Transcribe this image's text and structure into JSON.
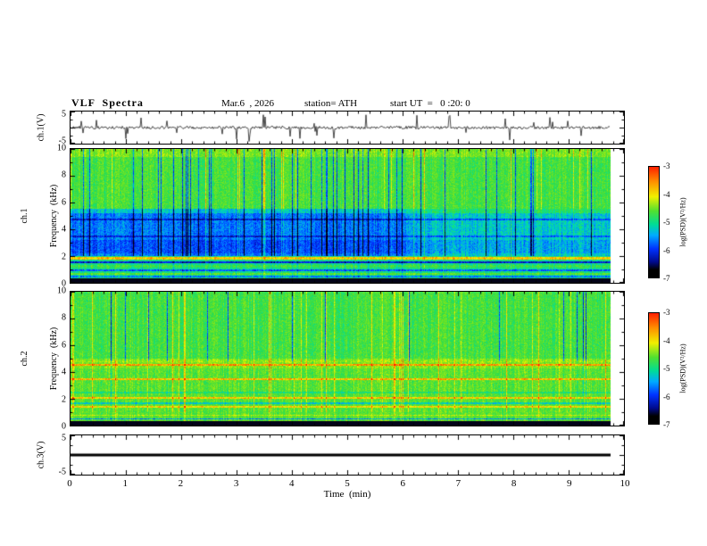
{
  "header": {
    "title": "VLF  Spectra",
    "date": "Mar.6  , 2026",
    "station": "station= ATH",
    "start_ut": "start UT  =   0 :20: 0"
  },
  "xaxis": {
    "label": "Time  (min)",
    "ticks": [
      "0",
      "1",
      "2",
      "3",
      "4",
      "5",
      "6",
      "7",
      "8",
      "9",
      "10"
    ]
  },
  "panel_ch1_wave": {
    "ylabel": "ch.1(V)",
    "ytick_top": "5",
    "ytick_bottom": "-5"
  },
  "panel_ch1_spec": {
    "ylabel_channel": "ch.1",
    "ylabel_axis": "Frequency  (kHz)",
    "yticks": [
      "10",
      "8",
      "6",
      "4",
      "2",
      "0"
    ]
  },
  "panel_ch2_spec": {
    "ylabel_channel": "ch.2",
    "ylabel_axis": "Frequency  (kHz)",
    "yticks": [
      "10",
      "8",
      "6",
      "4",
      "2",
      "0"
    ]
  },
  "panel_ch3_wave": {
    "ylabel": "ch.3(V)",
    "ytick_top": "5",
    "ytick_bottom": "-5"
  },
  "colorbar": {
    "label": "log(PSD)(V²/Hz)",
    "ticks": [
      "-3",
      "-4",
      "-5",
      "-6",
      "-7"
    ]
  },
  "colors": {
    "frame": "#000000",
    "background": "#ffffff"
  },
  "chart_data": [
    {
      "type": "line",
      "panel": "ch.1 time series",
      "ylabel": "ch.1(V)",
      "ylim": [
        -5,
        5
      ],
      "xlim": [
        0,
        10
      ],
      "x_units": "min",
      "description": "Broadband noisy waveform centered on 0 V with dense impulsive spikes reaching roughly +/-5 V; data extend from 0 to about 9.75 min"
    },
    {
      "type": "heatmap",
      "panel": "ch.1 spectrogram",
      "ylabel": "Frequency (kHz)",
      "ylim": [
        0,
        10
      ],
      "xlim": [
        0,
        10
      ],
      "x_units": "min",
      "color_scale": {
        "label": "log(PSD)(V²/Hz)",
        "min": -7,
        "max": -3,
        "colormap": "jet with black minimum"
      },
      "features": [
        "green/yellow background above ~5.5 kHz with many vertical bright (yellow) and dark (sferic) streaks",
        "blue low-power band between ~2 and 5.5 kHz, deepest blue before ~6 min, turning cyan-green afterwards",
        "dark horizontal lines near 4.75 and 3.5 kHz",
        "horizontally striped region below 2 kHz including a reddish line near 1.9 kHz and dark lines near 1.55 and 0.95 kHz",
        "solid black band below ~0.3 kHz"
      ]
    },
    {
      "type": "heatmap",
      "panel": "ch.2 spectrogram",
      "ylabel": "Frequency (kHz)",
      "ylim": [
        0,
        10
      ],
      "xlim": [
        0,
        10
      ],
      "x_units": "min",
      "color_scale": {
        "label": "log(PSD)(V²/Hz)",
        "min": -7,
        "max": -3,
        "colormap": "jet with black minimum"
      },
      "features": [
        "mostly green background with vertical yellow streaks and scattered dark-blue streaks above ~5 kHz",
        "bright horizontal red/orange lines near 4.55, 3.5, 2.1, 1.45 and 0.8 kHz",
        "cyan/green horizontal banding below ~2.5 kHz",
        "solid black band below ~0.3 kHz"
      ]
    },
    {
      "type": "line",
      "panel": "ch.3 time series",
      "ylabel": "ch.3(V)",
      "ylim": [
        -5,
        5
      ],
      "xlim": [
        0,
        10
      ],
      "x_units": "min",
      "description": "Flat thick black line at 0 V (no signal) from 0 to about 9.75 min"
    }
  ]
}
